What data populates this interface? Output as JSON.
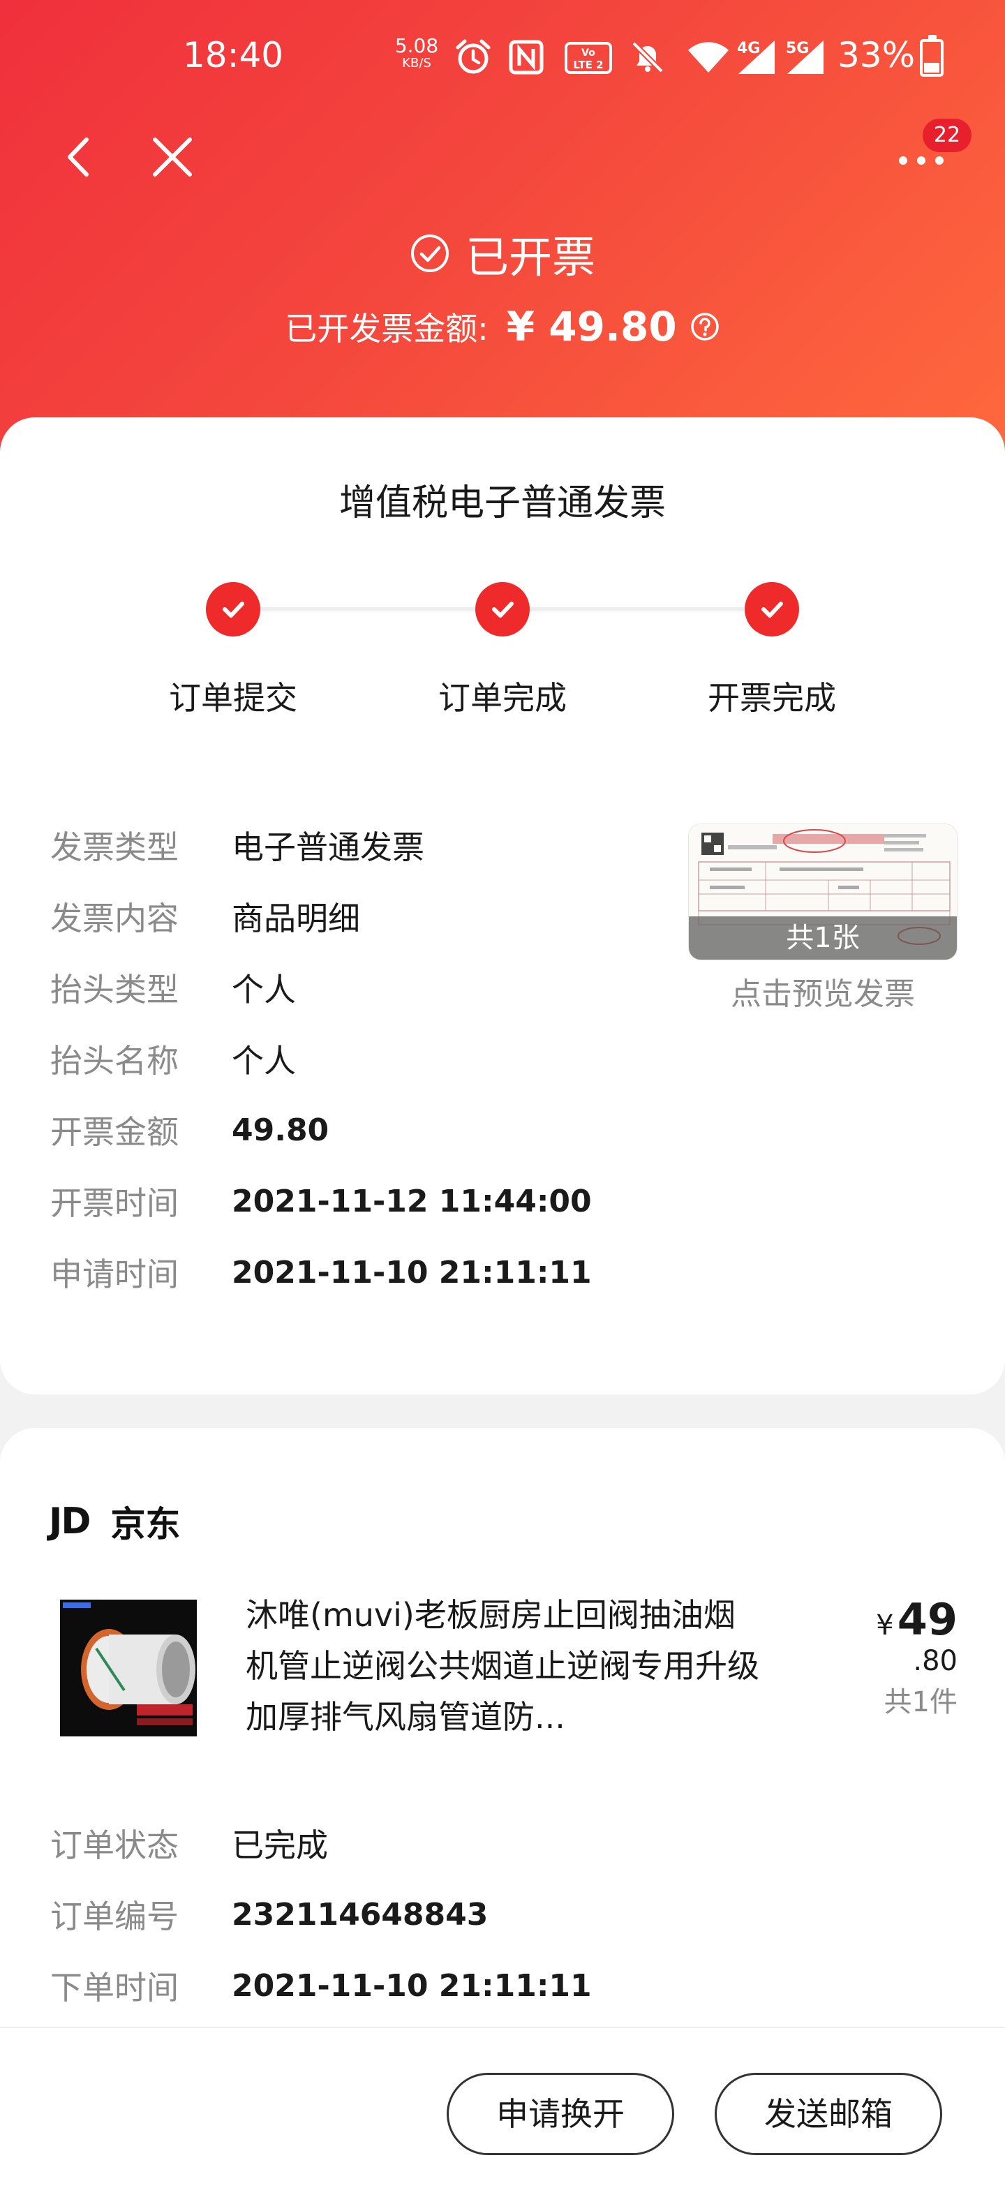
{
  "status_bar": {
    "time": "18:40",
    "net_speed_value": "5.08",
    "net_speed_unit": "KB/S",
    "volte_label": "LTE 2",
    "signal_4g": "4G",
    "signal_5g": "5G",
    "battery_percent": "33%"
  },
  "nav": {
    "badge_count": "22"
  },
  "header": {
    "status": "已开票",
    "amount_label": "已开发票金额:",
    "amount_value": "¥ 49.80"
  },
  "invoice": {
    "title": "增值税电子普通发票",
    "steps": [
      {
        "label": "订单提交"
      },
      {
        "label": "订单完成"
      },
      {
        "label": "开票完成"
      }
    ],
    "fields": [
      {
        "key": "发票类型",
        "value": "电子普通发票"
      },
      {
        "key": "发票内容",
        "value": "商品明细"
      },
      {
        "key": "抬头类型",
        "value": "个人"
      },
      {
        "key": "抬头名称",
        "value": "个人"
      },
      {
        "key": "开票金额",
        "value": "49.80"
      },
      {
        "key": "开票时间",
        "value": "2021-11-12 11:44:00"
      },
      {
        "key": "申请时间",
        "value": "2021-11-10 21:11:11"
      }
    ],
    "preview_count": "共1张",
    "preview_link": "点击预览发票"
  },
  "order": {
    "shop_logo": "JD",
    "shop_name": "京东",
    "product": {
      "title": "沐唯(muvi)老板厨房止回阀抽油烟机管止逆阀公共烟道止逆阀专用升级加厚排气风扇管道防...",
      "price_currency": "¥",
      "price_int": "49",
      "price_dec": ".80",
      "quantity": "共1件"
    },
    "fields": [
      {
        "key": "订单状态",
        "value": "已完成"
      },
      {
        "key": "订单编号",
        "value": "232114648843"
      },
      {
        "key": "下单时间",
        "value": "2021-11-10 21:11:11"
      }
    ]
  },
  "actions": {
    "reissue_label": "申请换开",
    "email_label": "发送邮箱"
  },
  "colors": {
    "header_gradient_start": "#f0303c",
    "header_gradient_end": "#ff6a3d",
    "step_done": "#ee2a2a",
    "badge": "#e8202e"
  }
}
